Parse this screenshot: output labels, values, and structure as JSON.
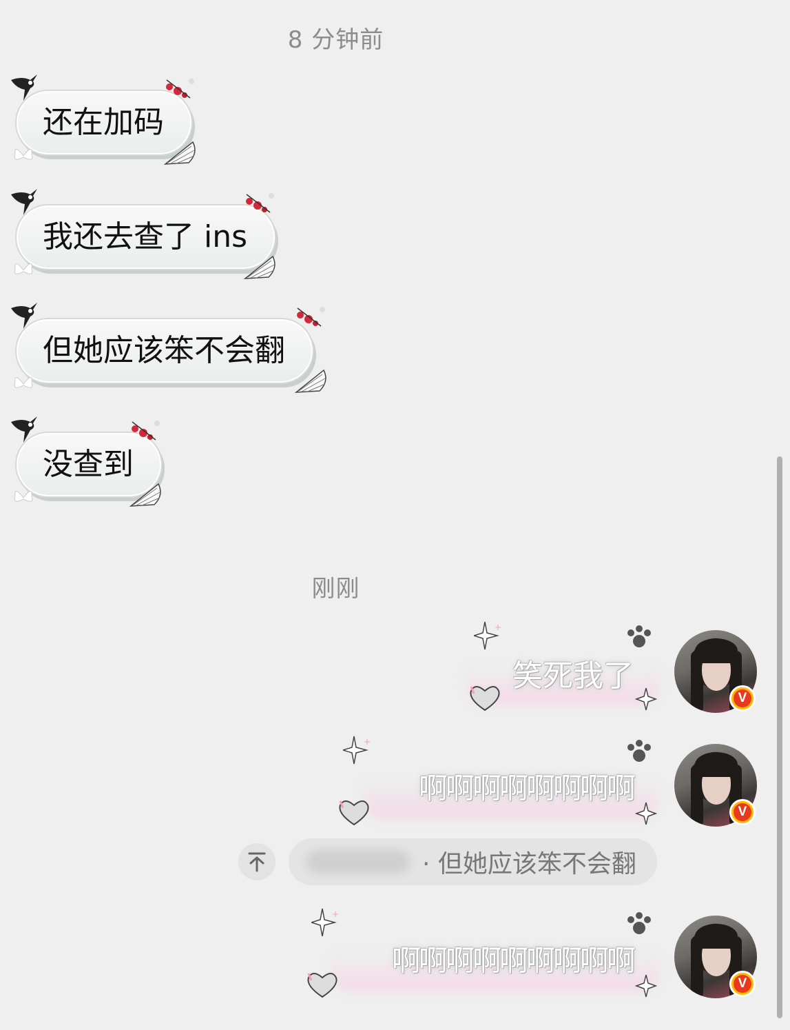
{
  "timestamps": {
    "earlier": "8 分钟前",
    "now": "刚刚"
  },
  "incoming": [
    {
      "text": "还在加码"
    },
    {
      "text": "我还去查了 ins"
    },
    {
      "text": "但她应该笨不会翻"
    },
    {
      "text": "没查到"
    }
  ],
  "outgoing": [
    {
      "text": "笑死我了"
    },
    {
      "text": "啊啊啊啊啊啊啊啊"
    },
    {
      "text": "啊啊啊啊啊啊啊啊啊"
    }
  ],
  "quote": {
    "text": "· 但她应该笨不会翻",
    "icon": "pin-to-top-icon"
  },
  "avatar": {
    "badge": "V",
    "badge_color": "#e8391e"
  },
  "colors": {
    "background": "#efefef",
    "bubble_border": "#d4d9d6",
    "blossom": "#d1283a",
    "glow": "#f6d2e4"
  }
}
